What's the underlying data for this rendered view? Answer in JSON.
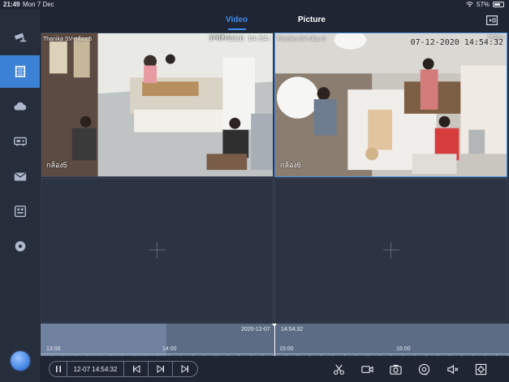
{
  "status_bar": {
    "time": "21:49",
    "date": "Mon 7 Dec",
    "battery": "57%"
  },
  "tabs": {
    "video": "Video",
    "picture": "Picture"
  },
  "sidebar": {
    "items": [
      {
        "icon": "camera-icon",
        "active": false
      },
      {
        "icon": "playback-film-icon",
        "active": true
      },
      {
        "icon": "cloud-icon",
        "active": false
      },
      {
        "icon": "device-icon",
        "active": false
      },
      {
        "icon": "mail-icon",
        "active": false
      },
      {
        "icon": "storage-icon",
        "active": false
      },
      {
        "icon": "disc-icon",
        "active": false
      }
    ]
  },
  "cameras": [
    {
      "name": "Thanika SV-กล้อง 5",
      "rate": "88KBps",
      "timestamp": "5-07-2020 14:54:",
      "label": "กล้อง5"
    },
    {
      "name": "Thanika SV-กล้อง 6",
      "rate": "?KBps",
      "timestamp": "07-12-2020 14:54:32",
      "label": "กล้อง6"
    }
  ],
  "timeline": {
    "cursor_date": "2020-12-07",
    "cursor_time": "14:54:32",
    "ticks": [
      "13:00",
      "14:00",
      "15:00",
      "16:00"
    ]
  },
  "controls": {
    "playback_time": "12-07 14:54:32"
  },
  "colors": {
    "accent": "#3f8df0",
    "sidebar_active": "#3b82d6"
  }
}
